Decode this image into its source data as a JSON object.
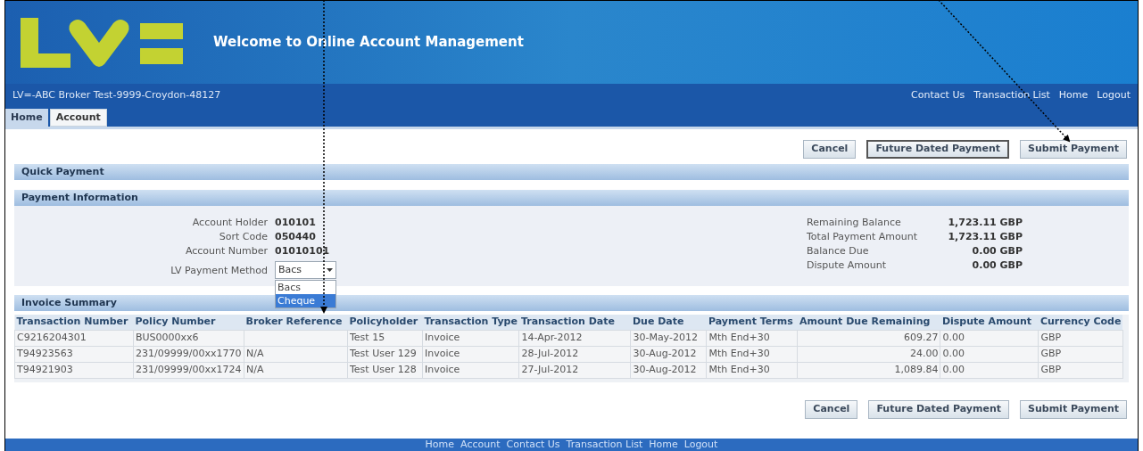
{
  "header": {
    "title": "Welcome to Online Account Management",
    "broker": "LV=-ABC Broker Test-9999-Croydon-48127",
    "global_links": [
      "Contact Us",
      "Transaction List",
      "Home",
      "Logout"
    ]
  },
  "tabs": [
    {
      "label": "Home",
      "selected": false
    },
    {
      "label": "Account",
      "selected": true
    }
  ],
  "top_buttons": [
    "Cancel",
    "Future Dated Payment",
    "Submit Payment"
  ],
  "quick_payment": {
    "title": "Quick Payment"
  },
  "payment_information": {
    "title": "Payment Information",
    "left_fields": [
      {
        "label": "Account Holder",
        "value": "010101"
      },
      {
        "label": "Sort Code",
        "value": "050440"
      },
      {
        "label": "Account Number",
        "value": "01010101"
      }
    ],
    "payment_method": {
      "label": "LV Payment Method",
      "value": "Bacs",
      "options": [
        {
          "label": "Bacs",
          "highlighted": false
        },
        {
          "label": "Cheque",
          "highlighted": true
        }
      ]
    },
    "right_fields": [
      {
        "label": "Remaining Balance",
        "value": "1,723.11 GBP"
      },
      {
        "label": "Total Payment Amount",
        "value": "1,723.11 GBP"
      },
      {
        "label": "Balance Due",
        "value": "0.00 GBP"
      },
      {
        "label": "Dispute Amount",
        "value": "0.00 GBP"
      }
    ]
  },
  "invoice_summary": {
    "title": "Invoice Summary",
    "columns": [
      "Transaction Number",
      "Policy Number",
      "Broker Reference",
      "Policyholder",
      "Transaction Type",
      "Transaction Date",
      "Due Date",
      "Payment Terms",
      "Amount Due Remaining",
      "Dispute Amount",
      "Currency Code"
    ],
    "rows": [
      [
        "C9216204301",
        "BUS0000xx6",
        "",
        "Test 15",
        "Invoice",
        "14-Apr-2012",
        "30-May-2012",
        "Mth End+30",
        "609.27",
        "0.00",
        "GBP"
      ],
      [
        "T94923563",
        "231/09999/00xx1770",
        "N/A",
        "Test User 129",
        "Invoice",
        "28-Jul-2012",
        "30-Aug-2012",
        "Mth End+30",
        "24.00",
        "0.00",
        "GBP"
      ],
      [
        "T94921903",
        "231/09999/00xx1724",
        "N/A",
        "Test User 128",
        "Invoice",
        "27-Jul-2012",
        "30-Aug-2012",
        "Mth End+30",
        "1,089.84",
        "0.00",
        "GBP"
      ]
    ]
  },
  "bottom_buttons": [
    "Cancel",
    "Future Dated Payment",
    "Submit Payment"
  ],
  "footer_links": [
    "Home",
    "Account",
    "Contact Us",
    "Transaction List",
    "Home",
    "Logout"
  ]
}
